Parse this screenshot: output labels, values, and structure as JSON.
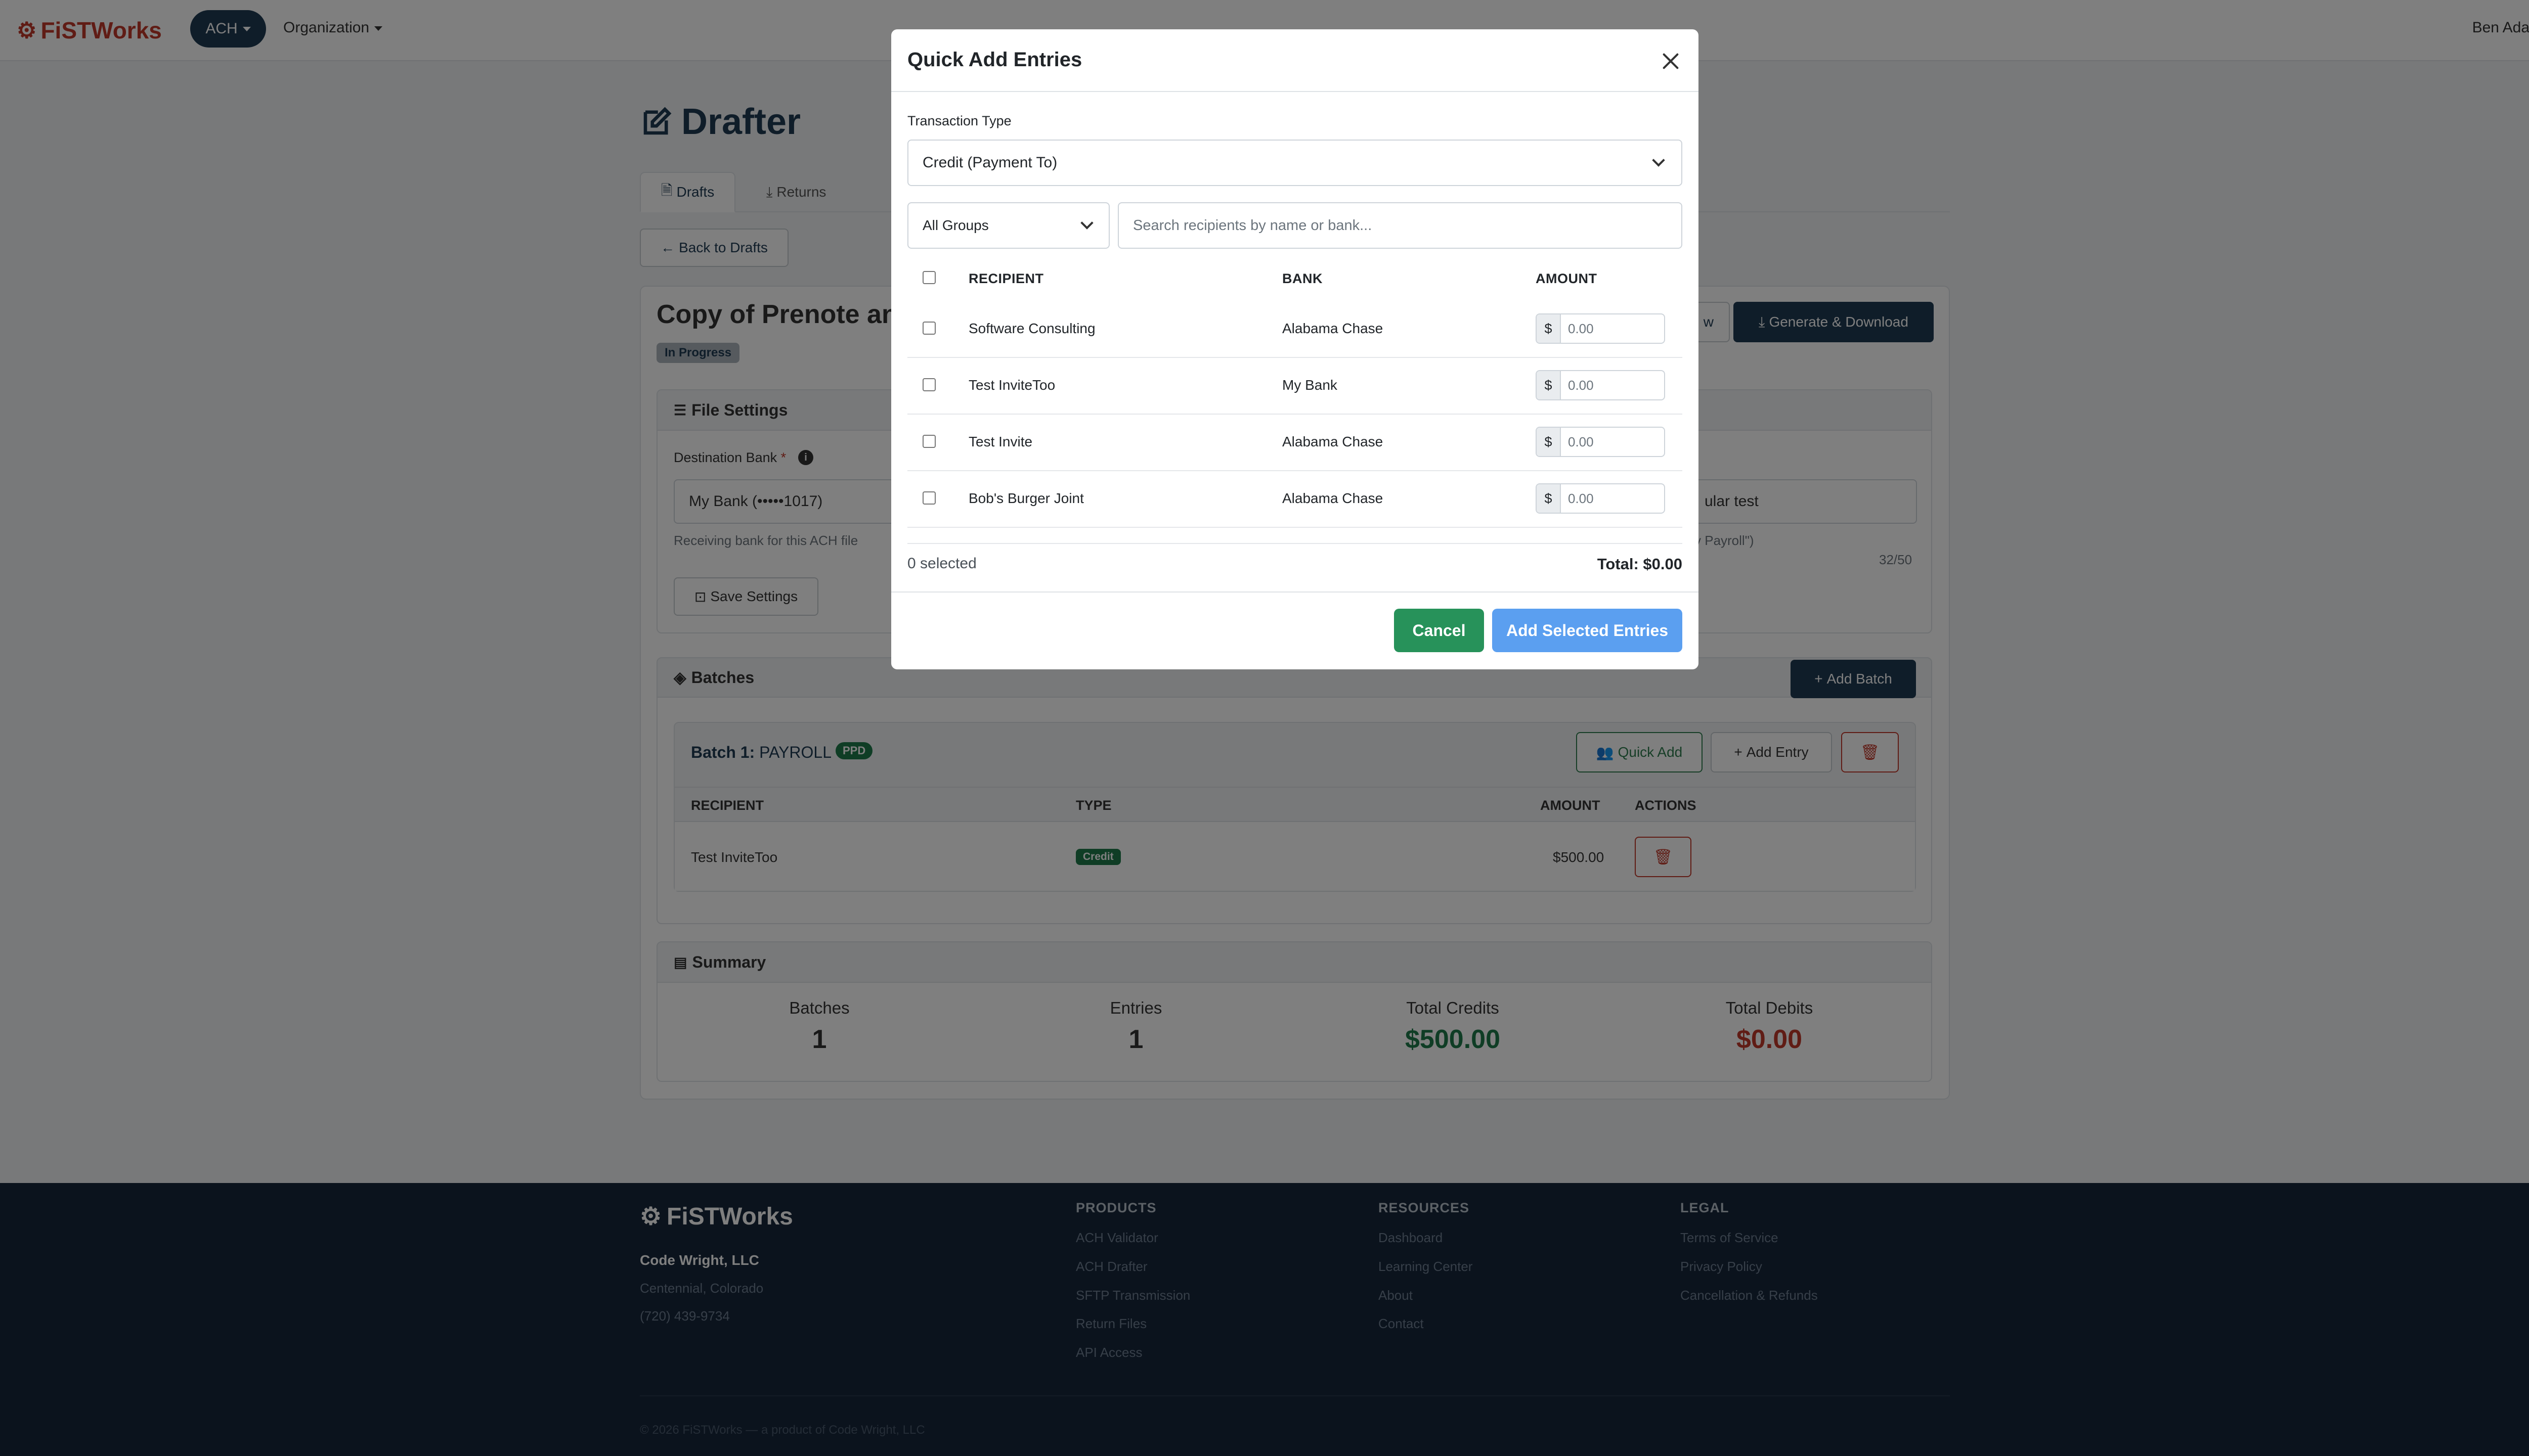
{
  "nav": {
    "brand": "FiSTWorks",
    "ach_label": "ACH",
    "org_label": "Organization",
    "user_label": "Ben Adam"
  },
  "page": {
    "title": "Drafter",
    "tabs": [
      {
        "label": "Drafts",
        "active": true
      },
      {
        "label": "Returns",
        "active": false
      }
    ],
    "back_label": "Back to Drafts",
    "draft_name": "Copy of Prenote and",
    "status": "In Progress",
    "preview_label": "w",
    "generate_label": "Generate & Download"
  },
  "file_settings": {
    "title": "File Settings",
    "dest_label": "Destination Bank",
    "required_mark": "*",
    "dest_value": "My Bank (•••••1017)",
    "dest_help": "Receiving bank for this ACH file",
    "desc_value": "ular test",
    "desc_help": "y Payroll\")",
    "char_count": "32/50",
    "save_label": "Save Settings"
  },
  "batches": {
    "title": "Batches",
    "add_batch_label": "Add Batch",
    "batch": {
      "title_bold": "Batch 1:",
      "title_name": "PAYROLL",
      "sec_code": "PPD",
      "quick_add_label": "Quick Add",
      "add_entry_label": "Add Entry",
      "columns": [
        "RECIPIENT",
        "TYPE",
        "AMOUNT",
        "ACTIONS"
      ],
      "entries": [
        {
          "recipient": "Test InviteToo",
          "type": "Credit",
          "amount": "$500.00"
        }
      ]
    }
  },
  "summary": {
    "title": "Summary",
    "items": [
      {
        "label": "Batches",
        "value": "1"
      },
      {
        "label": "Entries",
        "value": "1"
      },
      {
        "label": "Total Credits",
        "value": "$500.00"
      },
      {
        "label": "Total Debits",
        "value": "$0.00"
      }
    ],
    "colors": {
      "credits": "#1e7a4a",
      "debits": "#c0392b"
    }
  },
  "footer": {
    "brand": "FiSTWorks",
    "company": "Code Wright, LLC",
    "location": "Centennial, Colorado",
    "phone": "(720) 439-9734",
    "products_title": "PRODUCTS",
    "products": [
      "ACH Validator",
      "ACH Drafter",
      "SFTP Transmission",
      "Return Files",
      "API Access"
    ],
    "resources_title": "RESOURCES",
    "resources": [
      "Dashboard",
      "Learning Center",
      "About",
      "Contact"
    ],
    "legal_title": "LEGAL",
    "legal": [
      "Terms of Service",
      "Privacy Policy",
      "Cancellation & Refunds"
    ],
    "copyright": "© 2026 FiSTWorks — a product of Code Wright, LLC"
  },
  "modal": {
    "title": "Quick Add Entries",
    "transaction_type_label": "Transaction Type",
    "transaction_type_value": "Credit (Payment To)",
    "group_value": "All Groups",
    "search_placeholder": "Search recipients by name or bank...",
    "columns": [
      "RECIPIENT",
      "BANK",
      "AMOUNT"
    ],
    "currency_symbol": "$",
    "rows": [
      {
        "recipient": "Software Consulting",
        "bank": "Alabama Chase",
        "amount_placeholder": "0.00"
      },
      {
        "recipient": "Test InviteToo",
        "bank": "My Bank",
        "amount_placeholder": "0.00"
      },
      {
        "recipient": "Test Invite",
        "bank": "Alabama Chase",
        "amount_placeholder": "0.00"
      },
      {
        "recipient": "Bob's Burger Joint",
        "bank": "Alabama Chase",
        "amount_placeholder": "0.00"
      }
    ],
    "selected_count": "0 selected",
    "total": "Total: $0.00",
    "cancel_label": "Cancel",
    "add_selected_label": "Add Selected Entries"
  },
  "colors": {
    "brand": "#c0392b",
    "navy": "#1f3a52",
    "success": "#27925a",
    "primary_disabled": "#5b9ff0",
    "danger": "#c0392b"
  }
}
